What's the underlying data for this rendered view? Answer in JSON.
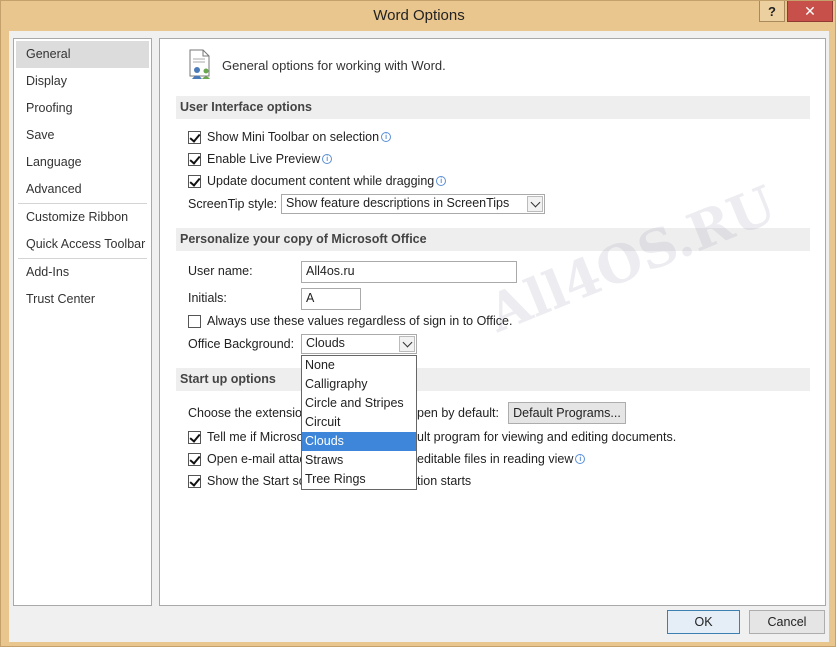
{
  "window": {
    "title": "Word Options",
    "help_label": "?",
    "close_label": "✕"
  },
  "nav": {
    "groups": [
      [
        "General",
        "Display",
        "Proofing",
        "Save",
        "Language",
        "Advanced"
      ],
      [
        "Customize Ribbon",
        "Quick Access Toolbar"
      ],
      [
        "Add-Ins",
        "Trust Center"
      ]
    ],
    "selected": "General"
  },
  "header": {
    "text": "General options for working with Word."
  },
  "ui_options": {
    "title": "User Interface options",
    "mini_toolbar": "Show Mini Toolbar on selection",
    "live_preview": "Enable Live Preview",
    "update_content": "Update document content while dragging",
    "screentip_label": "ScreenTip style:",
    "screentip_value": "Show feature descriptions in ScreenTips"
  },
  "personalize": {
    "title": "Personalize your copy of Microsoft Office",
    "username_label": "User name:",
    "username_value": "All4os.ru",
    "initials_label": "Initials:",
    "initials_value": "A",
    "always_use": "Always use these values regardless of sign in to Office.",
    "background_label": "Office Background:",
    "background_value": "Clouds",
    "background_options": [
      "None",
      "Calligraphy",
      "Circle and Stripes",
      "Circuit",
      "Clouds",
      "Straws",
      "Tree Rings"
    ]
  },
  "startup": {
    "title": "Start up options",
    "choose_ext_left": "Choose the extension",
    "choose_ext_right": "pen by default:",
    "default_programs": "Default Programs...",
    "tell_me_left": "Tell me if Microso",
    "tell_me_right": "ult program for viewing and editing documents.",
    "open_email_left": "Open e-mail attac",
    "open_email_right": "editable files in reading view",
    "show_start_left": "Show the Start scr",
    "show_start_right": "tion starts"
  },
  "footer": {
    "ok": "OK",
    "cancel": "Cancel"
  },
  "watermark": "All4OS.RU",
  "colors": {
    "accent": "#3d86d9",
    "close": "#c7504a",
    "frame": "#e9c68d"
  }
}
